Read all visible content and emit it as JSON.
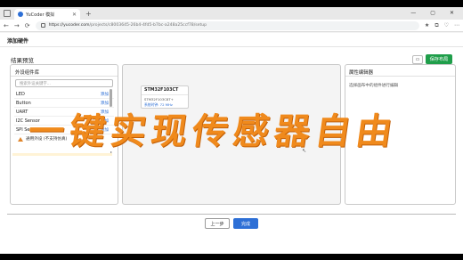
{
  "browser": {
    "tab_title": "YuCoder 模拟",
    "tab_close": "✕",
    "new_tab": "+",
    "window_controls": [
      "—",
      "▢",
      "✕"
    ],
    "nav": {
      "back": "←",
      "forward": "→",
      "reload": "⟳"
    },
    "url_host": "https://yucoder.com",
    "url_path": "/projects/c8003645-26b4-4fd5-b7bc-a248a25ccf78/setup",
    "toolbar_icons": [
      "★",
      "⧉",
      "♡",
      "⋯"
    ]
  },
  "page": {
    "heading": "添加硬件",
    "preview_title": "结果预览",
    "layout_icon": "▭",
    "save_layout": "保存布局"
  },
  "library": {
    "title": "外设组件库",
    "search_placeholder": "搜索外设关键字...",
    "items": [
      {
        "name": "LED",
        "action": "添加"
      },
      {
        "name": "Button",
        "action": "添加"
      },
      {
        "name": "UART",
        "action": "添加"
      },
      {
        "name": "I2C Sensor",
        "action": "添加"
      },
      {
        "name": "SPI Sensor",
        "action": "添加"
      }
    ],
    "warning": "通用外设 (不支持仿真)"
  },
  "canvas": {
    "chip_name": "STM32F103CT",
    "chip_package": "STM32F103C8T+",
    "chip_clock": "系统时钟: 72 MHz"
  },
  "properties": {
    "title": "属性编辑器",
    "hint": "选择画布中的组件进行编辑"
  },
  "footer": {
    "prev": "上一步",
    "done": "完成"
  },
  "overlay_text": "一键实现传感器自由",
  "colors": {
    "accent": "#2d6fd6",
    "save_green": "#1f9e4a",
    "overlay_orange": "#f08a1c"
  }
}
